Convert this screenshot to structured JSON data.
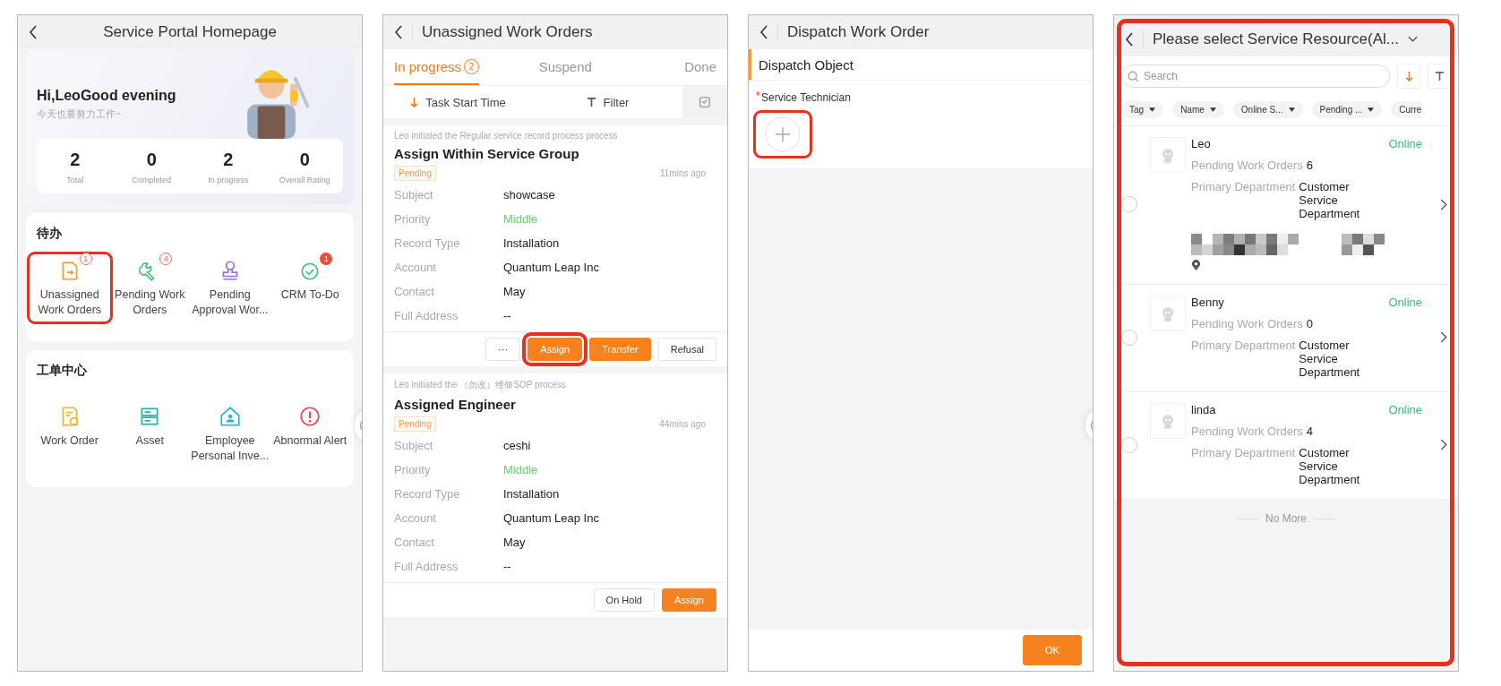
{
  "home": {
    "title": "Service Portal Homepage",
    "greeting": "Hi,LeoGood evening",
    "subtitle": "今天也要努力工作~",
    "stats": [
      {
        "value": "2",
        "label": "Total"
      },
      {
        "value": "0",
        "label": "Completed"
      },
      {
        "value": "2",
        "label": "In progress"
      },
      {
        "value": "0",
        "label": "Overall Rating"
      }
    ],
    "todo": {
      "title": "待办",
      "items": [
        {
          "label": "Unassigned Work Orders",
          "badge": {
            "text": "1",
            "filled": false
          },
          "highlighted": true
        },
        {
          "label": "Pending Work Orders",
          "badge": {
            "text": "4",
            "filled": false
          },
          "highlighted": false
        },
        {
          "label": "Pending Approval Wor...",
          "highlighted": false
        },
        {
          "label": "CRM To-Do",
          "badge": {
            "text": "1",
            "filled": true
          },
          "highlighted": false
        }
      ]
    },
    "work_center": {
      "title": "工单中心",
      "items": [
        {
          "label": "Work Order"
        },
        {
          "label": "Asset"
        },
        {
          "label": "Employee Personal Inve..."
        },
        {
          "label": "Abnormal Alert"
        }
      ]
    }
  },
  "work_orders": {
    "title": "Unassigned Work Orders",
    "tabs": [
      {
        "label": "In progress",
        "count": "2",
        "selected": true
      },
      {
        "label": "Suspend",
        "selected": false
      },
      {
        "label": "Done",
        "selected": false
      }
    ],
    "sort": "Task Start Time",
    "filter": "Filter",
    "cards": [
      {
        "initiator": "Leo initiated the Regular service record process process",
        "title": "Assign Within Service Group",
        "status": "Pending",
        "time": "11mins ago",
        "fields": [
          {
            "label": "Subject",
            "value": "showcase"
          },
          {
            "label": "Priority",
            "value": "Middle",
            "color": "#5fd35f"
          },
          {
            "label": "Record Type",
            "value": "Installation"
          },
          {
            "label": "Account",
            "value": "Quantum Leap Inc"
          },
          {
            "label": "Contact",
            "value": "May"
          },
          {
            "label": "Full Address",
            "value": "--"
          }
        ],
        "buttons": [
          {
            "label": "···",
            "kind": "plain",
            "highlighted": false
          },
          {
            "label": "Assign",
            "kind": "primary",
            "highlighted": true
          },
          {
            "label": "Transfer",
            "kind": "primary",
            "highlighted": false
          },
          {
            "label": "Refusal",
            "kind": "plain",
            "highlighted": false
          }
        ]
      },
      {
        "initiator": "Leo initiated the （勿改）维修SOP process",
        "title": "Assigned Engineer",
        "status": "Pending",
        "time": "44mins ago",
        "fields": [
          {
            "label": "Subject",
            "value": "ceshi"
          },
          {
            "label": "Priority",
            "value": "Middle",
            "color": "#5fd35f"
          },
          {
            "label": "Record Type",
            "value": "Installation"
          },
          {
            "label": "Account",
            "value": "Quantum Leap Inc"
          },
          {
            "label": "Contact",
            "value": "May"
          },
          {
            "label": "Full Address",
            "value": "--"
          }
        ],
        "buttons": [
          {
            "label": "On Hold",
            "kind": "plain",
            "highlighted": false
          },
          {
            "label": "Assign",
            "kind": "primary",
            "highlighted": false
          }
        ]
      }
    ]
  },
  "dispatch": {
    "title": "Dispatch Work Order",
    "section": "Dispatch Object",
    "field_label": "Service Technician",
    "required": true,
    "add_highlighted": true,
    "ok": "OK"
  },
  "resource_picker": {
    "title": "Please select Service Resource(Al...",
    "highlighted": true,
    "search_placeholder": "Search",
    "chips": [
      "Tag",
      "Name",
      "Online S...",
      "Pending ...",
      "Curre"
    ],
    "resources": [
      {
        "name": "Leo",
        "status": "Online",
        "pending_label": "Pending Work Orders",
        "pending": "6",
        "dept_label": "Primary Department",
        "dept": "Customer Service Department",
        "address_redacted": true,
        "selected": false
      },
      {
        "name": "Benny",
        "status": "Online",
        "pending_label": "Pending Work Orders",
        "pending": "0",
        "dept_label": "Primary Department",
        "dept": "Customer Service Department",
        "selected": false
      },
      {
        "name": "linda",
        "status": "Online",
        "pending_label": "Pending Work Orders",
        "pending": "4",
        "dept_label": "Primary Department",
        "dept": "Customer Service Department",
        "selected": false
      }
    ],
    "footer": "No More"
  }
}
